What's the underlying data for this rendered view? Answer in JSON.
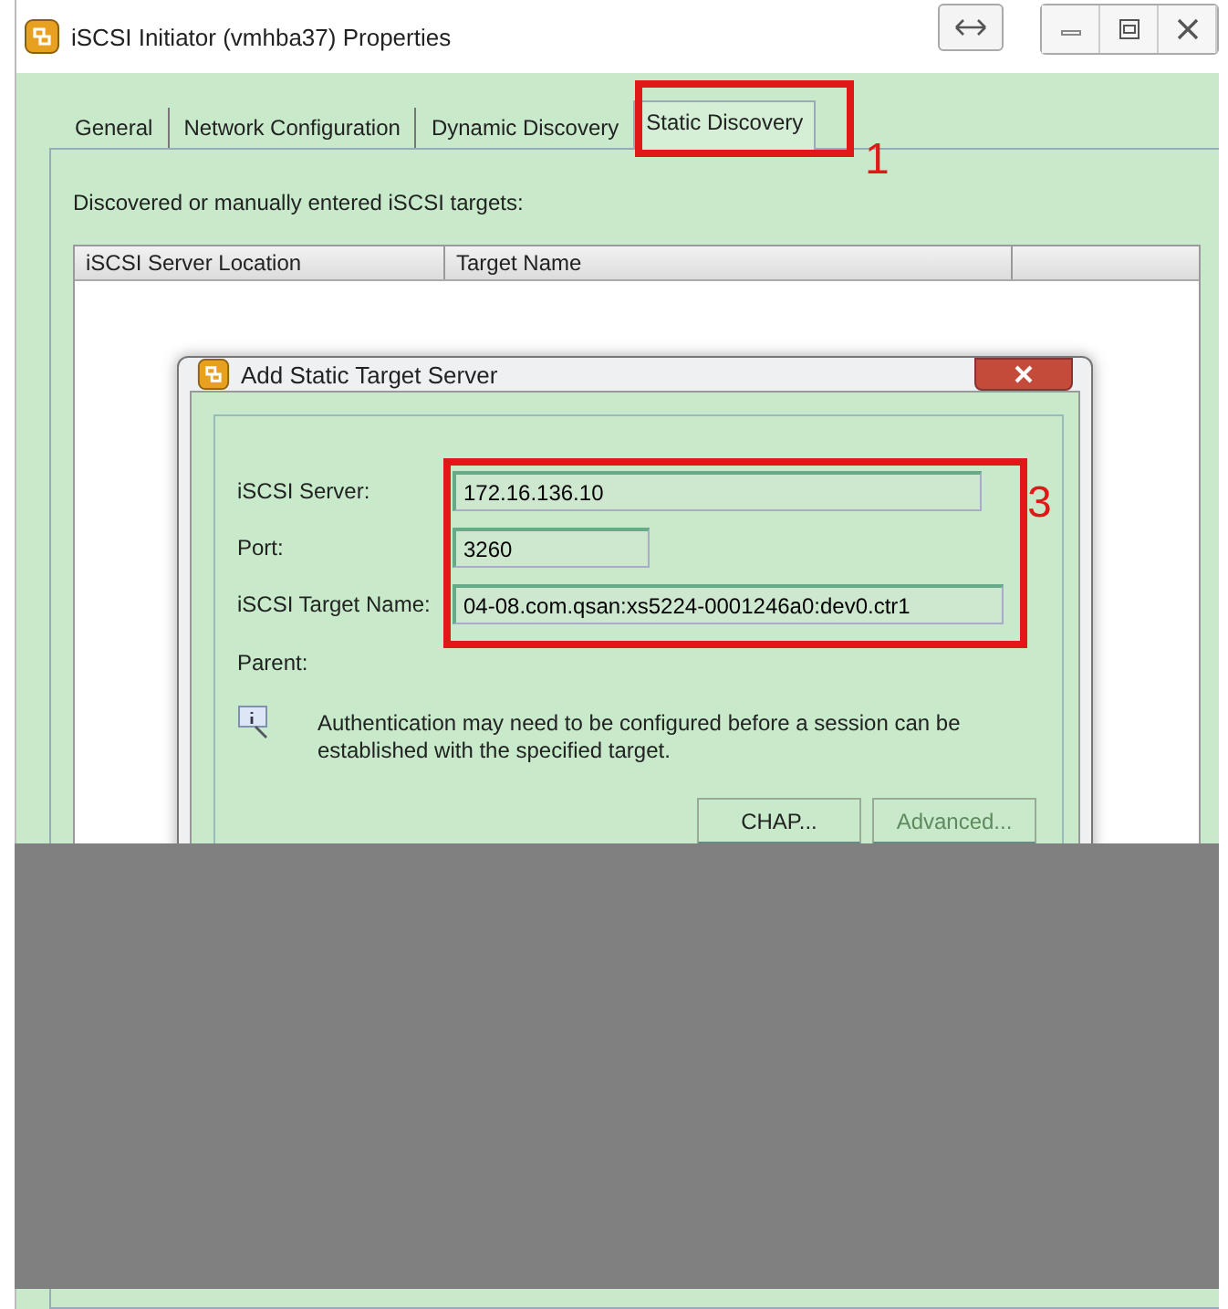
{
  "window": {
    "title": "iSCSI Initiator (vmhba37) Properties"
  },
  "tabs": [
    {
      "label": "General",
      "selected": false
    },
    {
      "label": "Network Configuration",
      "selected": false
    },
    {
      "label": "Dynamic Discovery",
      "selected": false
    },
    {
      "label": "Static Discovery",
      "selected": true
    }
  ],
  "targets_label": "Discovered or manually entered iSCSI targets:",
  "table": {
    "columns": [
      "iSCSI Server Location",
      "Target Name"
    ]
  },
  "dialog": {
    "title": "Add Static Target Server",
    "fields": [
      {
        "label": "iSCSI Server:",
        "value": "172.16.136.10",
        "kind": "wide"
      },
      {
        "label": "Port:",
        "value": "3260",
        "kind": "short"
      },
      {
        "label": "iSCSI Target Name:",
        "value": "04-08.com.qsan:xs5224-0001246a0:dev0.ctr1",
        "kind": "wide"
      }
    ],
    "parent_label": "Parent:",
    "info": "Authentication may need to be configured before a session can be established with the specified target.",
    "buttons": [
      {
        "label": "CHAP...",
        "disabled": false
      },
      {
        "label": "Advanced...",
        "disabled": true
      }
    ]
  },
  "annotations": [
    {
      "label": "1",
      "kind": "tab"
    },
    {
      "label": "3",
      "kind": "fields"
    }
  ]
}
